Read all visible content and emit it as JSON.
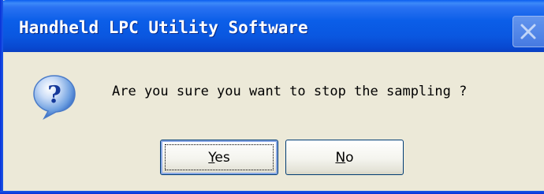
{
  "dialog": {
    "title": "Handheld LPC Utility Software",
    "message": "Are you sure you want to stop the sampling ?",
    "icon": "question-icon",
    "close_icon": "close-icon"
  },
  "buttons": {
    "yes": {
      "mnemonic": "Y",
      "rest": "es",
      "focused": true
    },
    "no": {
      "mnemonic": "N",
      "rest": "o",
      "focused": false
    }
  },
  "colors": {
    "titlebar": "#0a57e0",
    "dialog_background": "#ece9d8",
    "icon_blue": "#1f5fc7"
  }
}
